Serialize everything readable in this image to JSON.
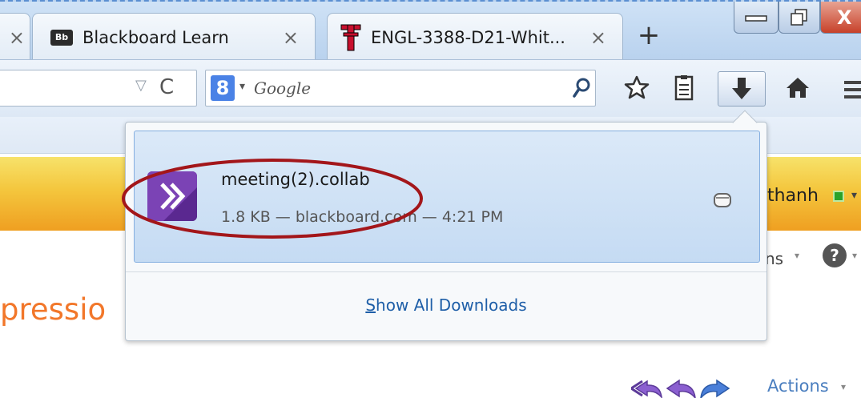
{
  "window": {
    "tabs": [
      {
        "label": "",
        "close": "×"
      },
      {
        "label": "Blackboard Learn",
        "icon": "blackboard-icon",
        "icon_text": "Bb",
        "close": "×"
      },
      {
        "label": "ENGL-3388-D21-Whit...",
        "icon": "texas-tech-icon",
        "close": "×"
      }
    ],
    "new_tab": "+",
    "controls": {
      "minimize": "minimize-icon",
      "maximize": "maximize-icon",
      "close": "X"
    }
  },
  "navbar": {
    "url_dropmarker": "▽",
    "reload": "C",
    "search": {
      "engine_icon_text": "8",
      "engine_dropdown": "▾",
      "placeholder": "Google"
    },
    "buttons": [
      "star-icon",
      "bookmarks-list-icon",
      "download-arrow-icon",
      "home-icon",
      "menu-icon"
    ]
  },
  "page": {
    "user": {
      "name": "thanh",
      "dropdown": "▾"
    },
    "options": {
      "label": "ns",
      "dropdown": "▾"
    },
    "help": {
      "label": "?",
      "dropdown": "▾"
    },
    "heading": "pressio",
    "actions": {
      "label": "Actions",
      "dropdown": "▾"
    }
  },
  "downloads_panel": {
    "item": {
      "filename": "meeting(2).collab",
      "status": "1.8 KB — blackboard.com — 4:21 PM",
      "icon": "collab-file-icon"
    },
    "show_all_underline": "S",
    "show_all_rest": "how All Downloads"
  },
  "colors": {
    "accent_orange": "#f2772a",
    "highlight_red": "#a3161a",
    "collab_purple": "#6a2f9a",
    "link_blue": "#1f5fa8"
  }
}
